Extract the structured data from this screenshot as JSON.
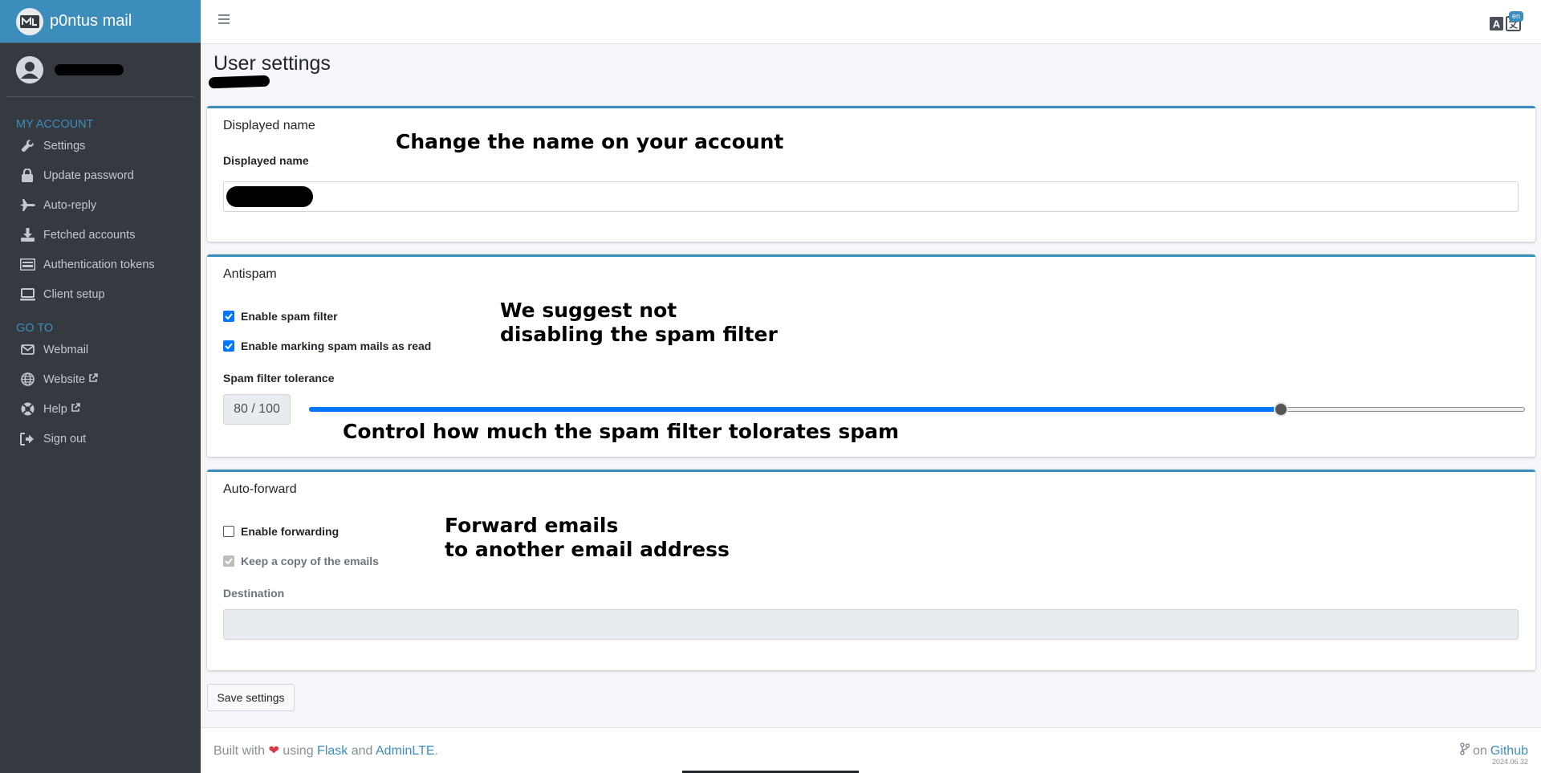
{
  "brand": {
    "name": "p0ntus mail"
  },
  "sidebar": {
    "section_account": "MY ACCOUNT",
    "account_items": [
      {
        "label": "Settings",
        "icon": "wrench-icon"
      },
      {
        "label": "Update password",
        "icon": "lock-icon"
      },
      {
        "label": "Auto-reply",
        "icon": "plane-icon"
      },
      {
        "label": "Fetched accounts",
        "icon": "download-icon"
      },
      {
        "label": "Authentication tokens",
        "icon": "token-icon"
      },
      {
        "label": "Client setup",
        "icon": "laptop-icon"
      }
    ],
    "section_goto": "GO TO",
    "goto_items": [
      {
        "label": "Webmail",
        "icon": "envelope-icon"
      },
      {
        "label": "Website",
        "icon": "globe-icon"
      },
      {
        "label": "Help",
        "icon": "lifebuoy-icon"
      },
      {
        "label": "Sign out",
        "icon": "sign-out-icon"
      }
    ]
  },
  "topbar": {
    "language_badge": "en"
  },
  "page": {
    "title": "User settings"
  },
  "displayed_name_card": {
    "title": "Displayed name",
    "field_label": "Displayed name",
    "annotation": "Change the name on your account"
  },
  "antispam_card": {
    "title": "Antispam",
    "enable_spam_filter": "Enable spam filter",
    "enable_marking_read": "Enable marking spam mails as read",
    "tolerance_label": "Spam filter tolerance",
    "tolerance_display": "80 / 100",
    "tolerance_value": 80,
    "tolerance_max": 100,
    "annotation_line1": "We suggest not",
    "annotation_line2": "disabling the spam filter",
    "annotation_slider": "Control how much the spam filter tolorates spam"
  },
  "autoforward_card": {
    "title": "Auto-forward",
    "enable_forwarding": "Enable forwarding",
    "keep_copy": "Keep a copy of the emails",
    "destination_label": "Destination",
    "annotation_line1": "Forward emails",
    "annotation_line2": "to another email address"
  },
  "save_button": "Save settings",
  "footer": {
    "built_with": "Built with",
    "using": "using",
    "flask": "Flask",
    "and": "and",
    "adminlte": "AdminLTE",
    "period": ".",
    "on": "on",
    "github": "Github",
    "version": "2024.06.32"
  },
  "colors": {
    "accent": "#3c8dbc",
    "sidebar_bg": "#343a40",
    "checkbox": "#0075ff",
    "heart": "#dc3545"
  }
}
